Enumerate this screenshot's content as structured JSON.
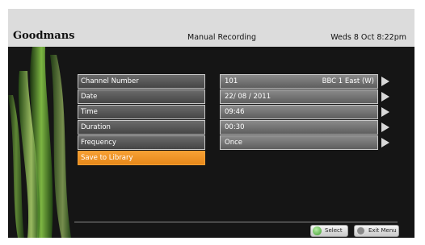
{
  "header": {
    "brand": "Goodmans",
    "title": "Manual Recording",
    "datetime": "Weds 8 Oct  8:22pm"
  },
  "form": {
    "labels": [
      "Channel Number",
      "Date",
      "Time",
      "Duration",
      "Frequency",
      "Save to Library"
    ],
    "active_index": 5,
    "values": [
      {
        "value": "101",
        "extra": "BBC 1 East (W)"
      },
      {
        "value": "22/ 08 / 2011",
        "extra": ""
      },
      {
        "value": "09:46",
        "extra": ""
      },
      {
        "value": "00:30",
        "extra": ""
      },
      {
        "value": "Once",
        "extra": ""
      }
    ]
  },
  "footer": {
    "select_label": "Select",
    "exit_label": "Exit Menu"
  },
  "colors": {
    "accent": "#f09326",
    "background": "#151515",
    "header": "#dcdcdc"
  },
  "icons": [
    "green-select-icon",
    "exit-icon",
    "chevron-right-icon"
  ]
}
